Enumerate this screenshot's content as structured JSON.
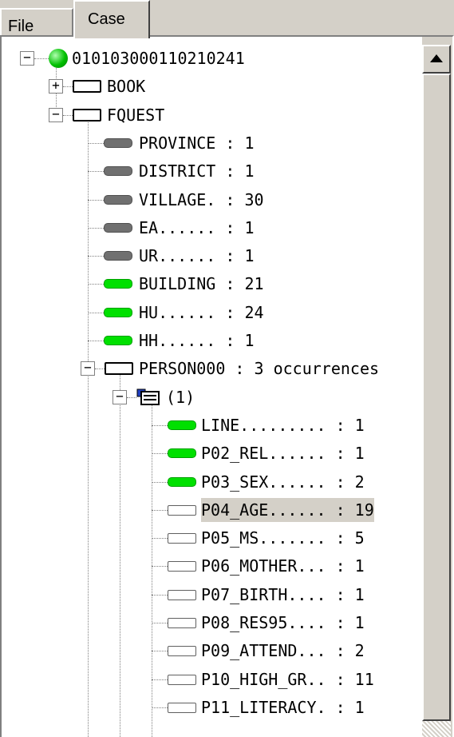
{
  "tabs": [
    "File",
    "Case"
  ],
  "active_tab": "Case",
  "tree": {
    "root": "010103000110210241",
    "book": "BOOK",
    "fquest": "FQUEST",
    "fields": [
      {
        "label": "PROVINCE : 1",
        "status": "gray"
      },
      {
        "label": "DISTRICT : 1",
        "status": "gray"
      },
      {
        "label": "VILLAGE. : 30",
        "status": "gray"
      },
      {
        "label": "EA...... : 1",
        "status": "gray"
      },
      {
        "label": "UR...... : 1",
        "status": "gray"
      },
      {
        "label": "BUILDING : 21",
        "status": "green"
      },
      {
        "label": "HU...... : 24",
        "status": "green"
      },
      {
        "label": "HH...... : 1",
        "status": "green"
      }
    ],
    "person": "PERSON000 : 3 occurrences",
    "occurrence": "(1)",
    "person_fields": [
      {
        "label": "LINE......... : 1",
        "status": "green"
      },
      {
        "label": "P02_REL...... : 1",
        "status": "green"
      },
      {
        "label": "P03_SEX...... : 2",
        "status": "green"
      },
      {
        "label": "P04_AGE...... : 19",
        "status": "empty",
        "selected": true
      },
      {
        "label": "P05_MS....... : 5",
        "status": "empty"
      },
      {
        "label": "P06_MOTHER... : 1",
        "status": "empty"
      },
      {
        "label": "P07_BIRTH.... : 1",
        "status": "empty"
      },
      {
        "label": "P08_RES95.... : 1",
        "status": "empty"
      },
      {
        "label": "P09_ATTEND... : 2",
        "status": "empty"
      },
      {
        "label": "P10_HIGH_GR.. : 11",
        "status": "empty"
      },
      {
        "label": "P11_LITERACY. : 1",
        "status": "empty"
      }
    ]
  },
  "colors": {
    "green": "#00e000",
    "gray": "#707070",
    "selected": "#d4d0c8"
  }
}
